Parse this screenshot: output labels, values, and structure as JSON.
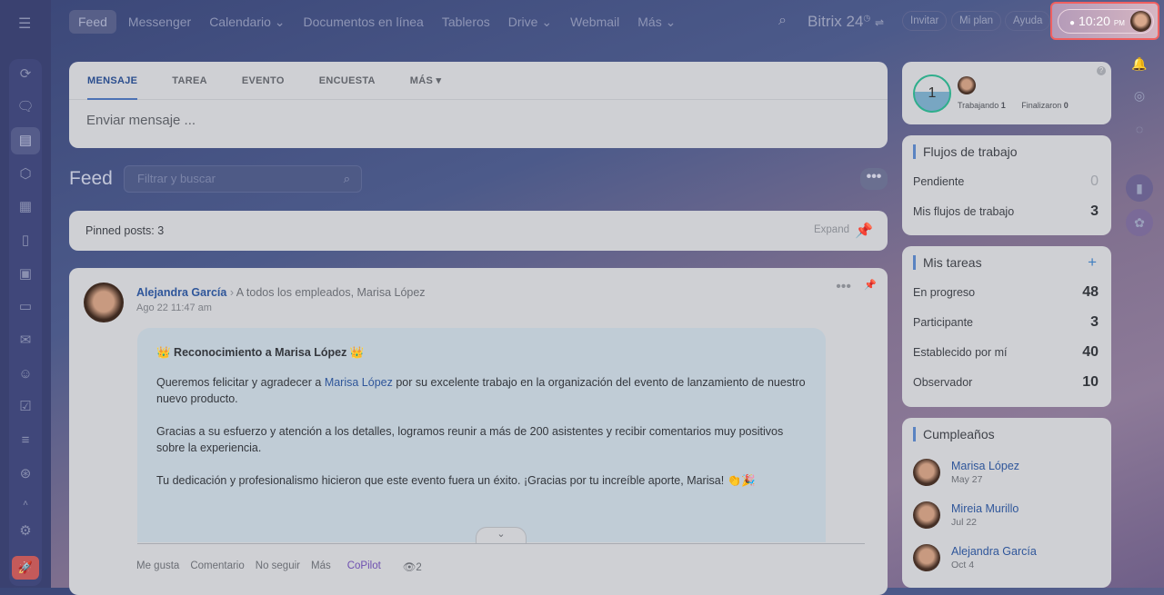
{
  "topbar": {
    "nav": [
      "Feed",
      "Messenger",
      "Calendario ⌄",
      "Documentos en línea",
      "Tableros",
      "Drive ⌄",
      "Webmail",
      "Más ⌄"
    ],
    "brand": "Bitrix 24",
    "invite": "Invitar",
    "plan": "Mi plan",
    "help": "Ayuda",
    "clock_time": "10:20",
    "clock_ampm": "PM"
  },
  "composer": {
    "tabs": [
      "MENSAJE",
      "TAREA",
      "EVENTO",
      "ENCUESTA",
      "MÁS ▾"
    ],
    "placeholder": "Enviar mensaje ..."
  },
  "feed": {
    "title": "Feed",
    "filter_placeholder": "Filtrar y buscar",
    "more": "•••"
  },
  "pinned": {
    "label": "Pinned posts: 3",
    "expand": "Expand"
  },
  "post": {
    "author": "Alejandra García",
    "recipients": "A todos los empleados, Marisa López",
    "date": "Ago 22 11:47 am",
    "title": "Reconocimiento a Marisa López",
    "p1_a": "Queremos felicitar y agradecer a ",
    "p1_link": "Marisa López",
    "p1_b": " por su excelente trabajo en la organización del evento de lanzamiento de nuestro nuevo producto.",
    "p2": "Gracias a su esfuerzo y atención a los detalles, logramos reunir a más de 200 asistentes y recibir comentarios muy positivos sobre la experiencia.",
    "p3": "Tu dedicación y profesionalismo hicieron que este evento fuera un éxito. ¡Gracias por tu increíble aporte, Marisa! 👏🎉",
    "actions": [
      "Me gusta",
      "Comentario",
      "No seguir",
      "Más"
    ],
    "copilot": "CoPilot",
    "views": "2"
  },
  "worktime": {
    "count": "1",
    "working_label": "Trabajando",
    "working": "1",
    "finished_label": "Finalizaron",
    "finished": "0"
  },
  "workflows": {
    "title": "Flujos de trabajo",
    "rows": [
      {
        "label": "Pendiente",
        "value": "0"
      },
      {
        "label": "Mis flujos de trabajo",
        "value": "3"
      }
    ]
  },
  "tasks": {
    "title": "Mis tareas",
    "rows": [
      {
        "label": "En progreso",
        "value": "48"
      },
      {
        "label": "Participante",
        "value": "3"
      },
      {
        "label": "Establecido por mí",
        "value": "40"
      },
      {
        "label": "Observador",
        "value": "10"
      }
    ]
  },
  "birthdays": {
    "title": "Cumpleaños",
    "people": [
      {
        "name": "Marisa López",
        "date": "May 27"
      },
      {
        "name": "Mireia Murillo",
        "date": "Jul 22"
      },
      {
        "name": "Alejandra García",
        "date": "Oct 4"
      }
    ]
  }
}
